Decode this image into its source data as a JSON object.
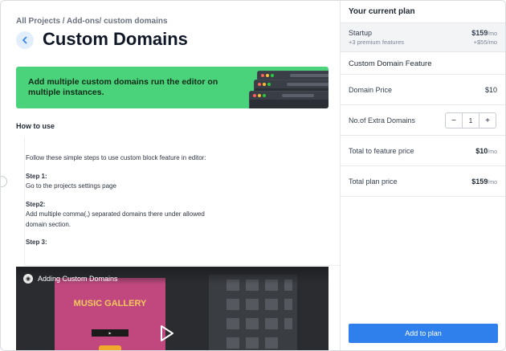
{
  "breadcrumb": "All Projects / Add-ons/ custom domains",
  "page_title": "Custom Domains",
  "banner": {
    "text": "Add multiple custom domains run the editor on multiple instances."
  },
  "how_to_use": {
    "heading": "How to use",
    "intro": "Follow these simple steps to use custom block feature in editor:",
    "steps": [
      {
        "label": "Step 1:",
        "text": "Go to the projects settings page"
      },
      {
        "label": "Step2:",
        "text": "Add multiple comma(,) separated domains there under allowed domain section."
      },
      {
        "label": "Step 3:",
        "text": ""
      }
    ]
  },
  "video": {
    "title": "Adding Custom Domains",
    "poster_title": "MUSIC GALLERY"
  },
  "plan_panel": {
    "heading": "Your current plan",
    "plan_name": "Startup",
    "plan_sub": "+3 premium features",
    "plan_price": "$159",
    "plan_price_unit": "/mo",
    "plan_extra": "+$55/mo",
    "feature_heading": "Custom Domain Feature",
    "domain_price_label": "Domain Price",
    "domain_price_value": "$10",
    "extra_domains_label": "No.of Extra Domains",
    "extra_domains_value": "1",
    "minus": "−",
    "plus": "+",
    "total_feature_label": "Total to feature price",
    "total_feature_value": "$10",
    "total_feature_unit": "/mo",
    "total_plan_label": "Total plan price",
    "total_plan_value": "$159",
    "total_plan_unit": "/mo",
    "add_button": "Add to plan"
  },
  "colors": {
    "accent": "#2f80ed",
    "banner": "#4ad37a"
  },
  "icons": [
    "chevron-left-icon",
    "play-icon",
    "video-logo-icon"
  ]
}
